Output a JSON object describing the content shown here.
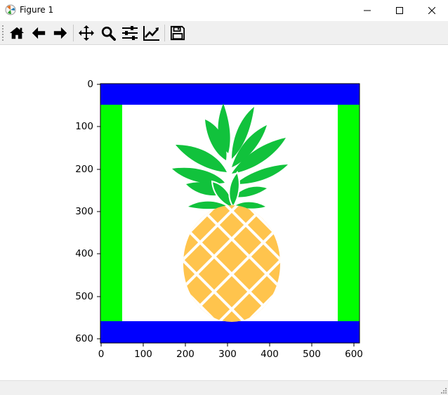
{
  "window": {
    "title": "Figure 1",
    "controls": [
      "minimize",
      "maximize",
      "close"
    ]
  },
  "toolbar": {
    "tools": [
      {
        "name": "home",
        "icon": "home-icon"
      },
      {
        "name": "back",
        "icon": "arrow-left-icon"
      },
      {
        "name": "forward",
        "icon": "arrow-right-icon"
      },
      {
        "name": "pan",
        "icon": "move-icon"
      },
      {
        "name": "zoom",
        "icon": "magnifier-icon"
      },
      {
        "name": "subplots",
        "icon": "sliders-icon"
      },
      {
        "name": "customize",
        "icon": "line-chart-icon"
      },
      {
        "name": "save",
        "icon": "floppy-disk-icon"
      }
    ]
  },
  "figure": {
    "type": "image",
    "x_ticks": [
      "0",
      "100",
      "200",
      "300",
      "400",
      "500",
      "600"
    ],
    "y_ticks": [
      "0",
      "100",
      "200",
      "300",
      "400",
      "500",
      "600"
    ],
    "xlim": [
      0,
      612
    ],
    "ylim": [
      612,
      0
    ],
    "colors": {
      "border_top_bottom": "#0000ff",
      "border_sides": "#00ff00",
      "background": "#ffffff",
      "pineapple_body": "#ffc44d",
      "pineapple_leaves": "#11c23c"
    }
  },
  "statusbar": {
    "text": ""
  }
}
